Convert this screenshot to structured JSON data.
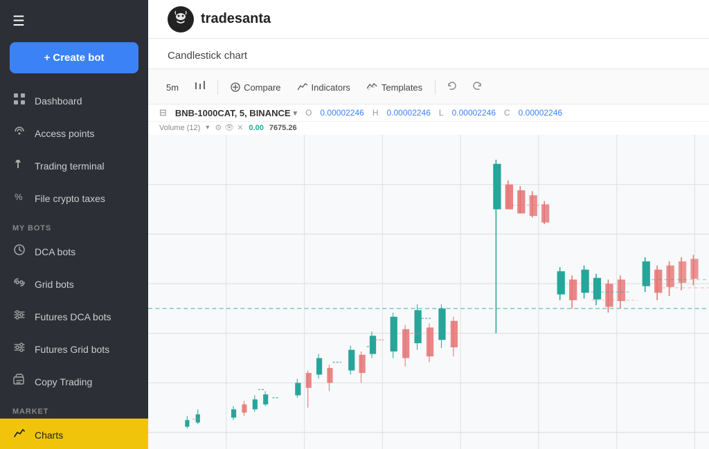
{
  "sidebar": {
    "hamburger_icon": "☰",
    "create_bot_label": "+ Create bot",
    "items_top": [
      {
        "id": "dashboard",
        "label": "Dashboard",
        "icon": "⊞",
        "active": false
      },
      {
        "id": "access-points",
        "label": "Access points",
        "icon": "🔧",
        "active": false
      },
      {
        "id": "trading-terminal",
        "label": "Trading terminal",
        "icon": "✋",
        "active": false
      },
      {
        "id": "file-crypto-taxes",
        "label": "File crypto taxes",
        "icon": "%",
        "active": false
      }
    ],
    "my_bots_label": "MY BOTS",
    "items_bots": [
      {
        "id": "dca-bots",
        "label": "DCA bots",
        "icon": "⟳",
        "active": false
      },
      {
        "id": "grid-bots",
        "label": "Grid bots",
        "icon": "⟳",
        "active": false
      },
      {
        "id": "futures-dca-bots",
        "label": "Futures DCA bots",
        "icon": "⚙",
        "active": false
      },
      {
        "id": "futures-grid-bots",
        "label": "Futures Grid bots",
        "icon": "⚙",
        "active": false
      },
      {
        "id": "copy-trading",
        "label": "Copy Trading",
        "icon": "🛒",
        "active": false
      }
    ],
    "market_label": "MARKET",
    "items_market": [
      {
        "id": "charts",
        "label": "Charts",
        "icon": "📈",
        "active": true
      }
    ]
  },
  "topbar": {
    "logo_emoji": "🤖",
    "logo_text": "tradesanta"
  },
  "chart": {
    "page_title": "Candlestick chart",
    "toolbar": {
      "timeframe": "5m",
      "timeframe_icon": "⏱",
      "compare_label": "Compare",
      "indicators_label": "Indicators",
      "templates_label": "Templates",
      "undo_icon": "←",
      "redo_icon": "→"
    },
    "pair_label": "BNB-1000CAT, 5, BINANCE",
    "ohlc": {
      "o_label": "O",
      "o_val": "0.00002246",
      "h_label": "H",
      "h_val": "0.00002246",
      "l_label": "L",
      "l_val": "0.00002246",
      "c_label": "C",
      "c_val": "0.00002246"
    },
    "volume_label": "Volume (12)",
    "volume_green": "0.00",
    "volume_num": "7675.26",
    "dashed_line_color": "#26a69a"
  }
}
